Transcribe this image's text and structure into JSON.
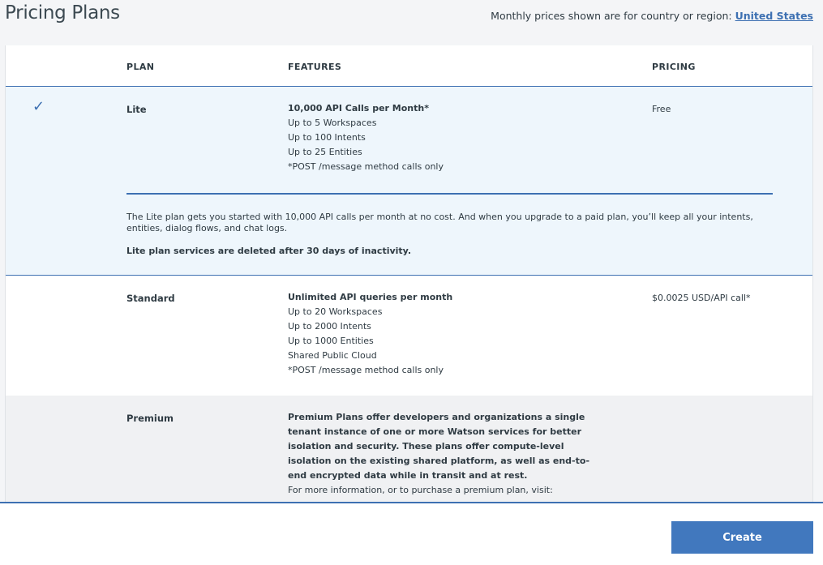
{
  "header": {
    "title": "Pricing Plans",
    "region_prefix": "Monthly prices shown are for country or region: ",
    "region_link": "United States"
  },
  "columns": {
    "plan": "PLAN",
    "features": "FEATURES",
    "pricing": "PRICING"
  },
  "plans": {
    "lite": {
      "selected_icon": "checkmark-icon",
      "name": "Lite",
      "features": [
        "10,000 API Calls per Month*",
        "Up to 5 Workspaces",
        "Up to 100 Intents",
        "Up to 25 Entities",
        "*POST /message method calls only"
      ],
      "price": "Free",
      "description": "The Lite plan gets you started with 10,000 API calls per month at no cost. And when you upgrade to a paid plan, you’ll keep all your intents, entities, dialog flows, and chat logs.",
      "notice": "Lite plan services are deleted after 30 days of inactivity."
    },
    "standard": {
      "name": "Standard",
      "features": [
        "Unlimited API queries per month",
        "Up to 20 Workspaces",
        "Up to 2000 Intents",
        "Up to 1000 Entities",
        "Shared Public Cloud",
        "*POST /message method calls only"
      ],
      "price": "$0.0025 USD/API call*"
    },
    "premium": {
      "name": "Premium",
      "features_bold": "Premium Plans offer developers and organizations a single tenant instance of one or more Watson services for better isolation and security. These plans offer compute-level isolation on the existing shared platform, as well as end-to-end encrypted data while in transit and at rest.",
      "features_more": "For more information, or to purchase a premium plan, visit:"
    }
  },
  "footer": {
    "create_label": "Create"
  },
  "colors": {
    "accent": "#3d70b2",
    "button": "#4178be",
    "selected_bg": "#eef6fc"
  }
}
